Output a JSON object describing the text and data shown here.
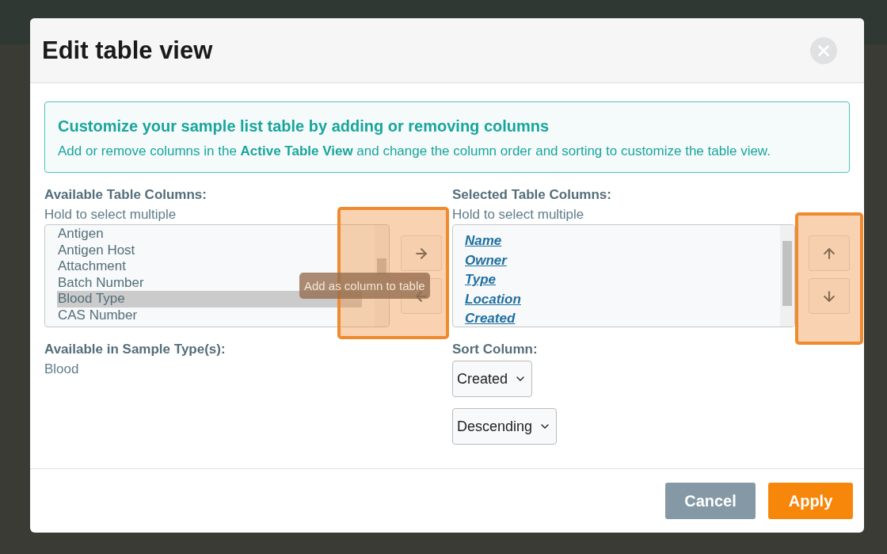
{
  "dialog": {
    "title": "Edit table view"
  },
  "info": {
    "heading": "Customize your sample list table by adding or removing columns",
    "text": "Add or remove columns in the **Active Table View** and change the column order and sorting to customize the table view."
  },
  "available": {
    "label": "Available Table Columns:",
    "hint": "Hold to select multiple",
    "items": [
      {
        "label": "Antigen",
        "selected": false
      },
      {
        "label": "Antigen Host",
        "selected": false
      },
      {
        "label": "Attachment",
        "selected": false
      },
      {
        "label": "Batch Number",
        "selected": false
      },
      {
        "label": "Blood Type",
        "selected": true
      },
      {
        "label": "CAS Number",
        "selected": false
      }
    ]
  },
  "tooltip": "Add as column to table",
  "selected_columns": {
    "label": "Selected Table Columns:",
    "hint": "Hold to select multiple",
    "items": [
      {
        "label": "Name"
      },
      {
        "label": "Owner"
      },
      {
        "label": "Type"
      },
      {
        "label": "Location"
      },
      {
        "label": "Created"
      }
    ]
  },
  "sample_types": {
    "label": "Available in Sample Type(s):",
    "value": "Blood"
  },
  "sort": {
    "label": "Sort Column:",
    "column": "Created",
    "order": "Descending"
  },
  "buttons": [
    {
      "label": "Cancel",
      "kind": "secondary"
    },
    {
      "label": "Apply",
      "kind": "primary"
    }
  ]
}
